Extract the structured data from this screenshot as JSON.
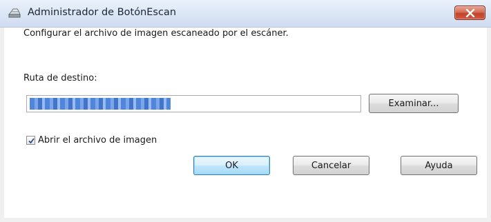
{
  "window": {
    "title": "Administrador de BotónEscan",
    "app_icon": "scanner-icon",
    "close_icon": "close-icon"
  },
  "content": {
    "description": "Configurar el archivo de imagen escaneado por el escáner.",
    "path_label": "Ruta de destino:",
    "path_value": ""
  },
  "buttons": {
    "browse": "Examinar...",
    "ok": "OK",
    "cancel": "Cancelar",
    "help": "Ayuda"
  },
  "checkbox": {
    "label": "Abrir el archivo de imagen",
    "checked": true
  },
  "colors": {
    "close_button": "#c2432a",
    "titlebar": "#dde8f6",
    "ok_button_border": "#3c7fb1"
  }
}
